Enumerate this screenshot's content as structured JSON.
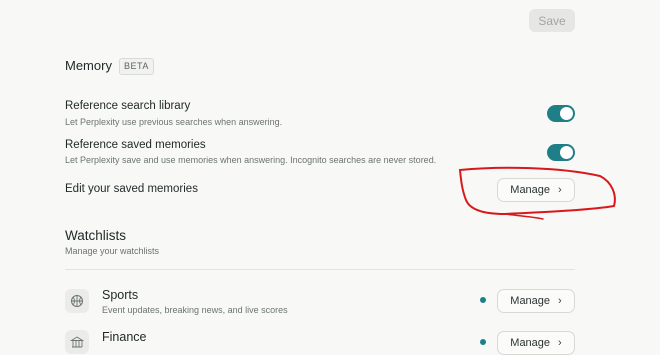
{
  "header": {
    "save_label": "Save"
  },
  "memory": {
    "title": "Memory",
    "badge": "BETA",
    "rows": [
      {
        "label": "Reference search library",
        "description": "Let Perplexity use previous searches when answering.",
        "enabled": true
      },
      {
        "label": "Reference saved memories",
        "description": "Let Perplexity save and use memories when answering. Incognito searches are never stored.",
        "enabled": true
      }
    ],
    "edit_label": "Edit your saved memories",
    "manage_label": "Manage"
  },
  "watchlists": {
    "title": "Watchlists",
    "description": "Manage your watchlists",
    "items": [
      {
        "title": "Sports",
        "description": "Event updates, breaking news, and live scores",
        "manage_label": "Manage",
        "icon": "basketball-icon"
      },
      {
        "title": "Finance",
        "description": "",
        "manage_label": "Manage",
        "icon": "finance-icon"
      }
    ]
  },
  "colors": {
    "accent": "#1f7f86",
    "annotation": "#d7191c"
  }
}
